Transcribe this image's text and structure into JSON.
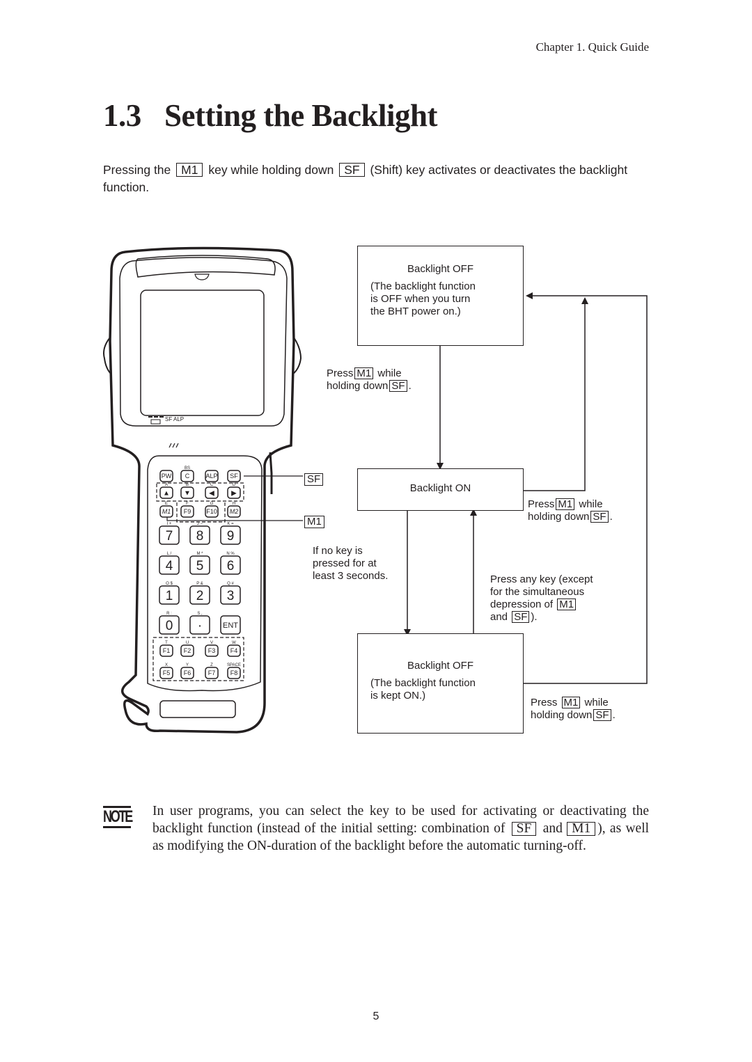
{
  "header": {
    "chapter": "Chapter 1.  Quick Guide"
  },
  "title": {
    "number": "1.3",
    "text": "Setting the Backlight"
  },
  "intro": {
    "part1": "Pressing the",
    "key1": "M1",
    "part2": "key while holding down",
    "key2": "SF",
    "part3": "(Shift) key activates or deactivates the backlight function."
  },
  "device": {
    "status_indicators": "SF  ALP",
    "callouts": {
      "sf": "SF",
      "m1": "M1"
    },
    "top_keys": [
      {
        "label": "PW",
        "alt": ""
      },
      {
        "label": "C",
        "alt": "BS"
      },
      {
        "label": "ALP",
        "alt": ""
      },
      {
        "label": "SF",
        "alt": ""
      }
    ],
    "arrow_keys": [
      {
        "label": "▲",
        "alt": "A",
        "name": "up-arrow"
      },
      {
        "label": "▼",
        "alt": "B",
        "name": "down-arrow"
      },
      {
        "label": "◀",
        "alt": "C",
        "name": "left-arrow"
      },
      {
        "label": "▶",
        "alt": "D",
        "name": "right-arrow"
      }
    ],
    "func_keys_row": [
      {
        "label": "M1",
        "alt": "E"
      },
      {
        "label": "F9",
        "alt": "F"
      },
      {
        "label": "F10",
        "alt": "G"
      },
      {
        "label": "M2",
        "alt": "H"
      }
    ],
    "num_keys": [
      {
        "label": "7",
        "alt": "I  +"
      },
      {
        "label": "8",
        "alt": "J  −"
      },
      {
        "label": "9",
        "alt": "K  ="
      },
      {
        "label": "4",
        "alt": "L  /"
      },
      {
        "label": "5",
        "alt": "M  *"
      },
      {
        "label": "6",
        "alt": "N  %"
      },
      {
        "label": "1",
        "alt": "O  $"
      },
      {
        "label": "2",
        "alt": "P  &"
      },
      {
        "label": "3",
        "alt": "Q  #"
      },
      {
        "label": "0",
        "alt": "R  :"
      },
      {
        "label": "·",
        "alt": "S  ,"
      },
      {
        "label": "ENT",
        "alt": ""
      }
    ],
    "f_keys": [
      {
        "label": "F1",
        "alt": "T"
      },
      {
        "label": "F2",
        "alt": "U"
      },
      {
        "label": "F3",
        "alt": "V"
      },
      {
        "label": "F4",
        "alt": "W"
      },
      {
        "label": "F5",
        "alt": "X"
      },
      {
        "label": "F6",
        "alt": "Y"
      },
      {
        "label": "F7",
        "alt": "Z"
      },
      {
        "label": "F8",
        "alt": "SPACE"
      }
    ]
  },
  "flow": {
    "state_off_initial": {
      "title": "Backlight OFF",
      "desc": [
        "(The backlight function",
        "is OFF when you turn",
        "the BHT power on.)"
      ]
    },
    "state_on": {
      "title": "Backlight ON"
    },
    "state_off_kept": {
      "title": "Backlight OFF",
      "desc": [
        "(The backlight function",
        "is kept ON.)"
      ]
    },
    "transition_off_to_on": {
      "line1_a": "Press",
      "key1": "M1",
      "line1_b": "while",
      "line2_a": "holding down",
      "key2": "SF",
      "line2_b": "."
    },
    "transition_on_to_off": {
      "line1_a": "Press",
      "key1": "M1",
      "line1_b": "while",
      "line2_a": "holding down",
      "key2": "SF",
      "line2_b": "."
    },
    "transition_timeout": [
      "If no key is",
      "pressed for at",
      "least 3 seconds."
    ],
    "transition_anykey": {
      "line1": "Press any key (except",
      "line2": "for the simultaneous",
      "line3_a": "depression of",
      "key1": "M1",
      "line4_a": "and",
      "key2": "SF",
      "line4_b": ")."
    },
    "transition_kept_to_off": {
      "line1_a": "Press",
      "key1": "M1",
      "line1_b": "while",
      "line2_a": "holding down",
      "key2": "SF",
      "line2_b": "."
    }
  },
  "note": {
    "icon_label": "NOTE",
    "part1": "In user programs, you can select the key to be used for activating or deactivating the backlight function (instead of the initial setting:  combination of",
    "key1": "SF",
    "part2": "and",
    "key2": "M1",
    "part3": "), as well as modifying the ON-duration of the backlight before the automatic turning-off."
  },
  "page_number": "5"
}
